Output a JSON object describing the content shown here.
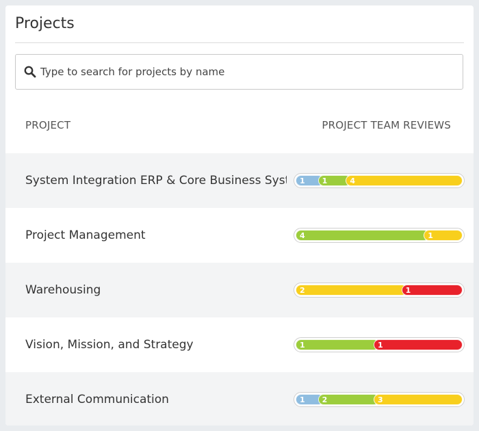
{
  "title": "Projects",
  "search": {
    "placeholder": "Type to search for projects by name"
  },
  "columns": {
    "project": "PROJECT",
    "reviews": "PROJECT TEAM REVIEWS"
  },
  "colors": {
    "blue": "#8fbde0",
    "green": "#9ccd3c",
    "yellow": "#f8cf1d",
    "red": "#e8222b"
  },
  "projects": [
    {
      "name": "System Integration ERP & Core Business Syste",
      "reviews": [
        {
          "status": "blue",
          "count": 1
        },
        {
          "status": "green",
          "count": 1
        },
        {
          "status": "yellow",
          "count": 4
        }
      ]
    },
    {
      "name": "Project Management",
      "reviews": [
        {
          "status": "green",
          "count": 4
        },
        {
          "status": "yellow",
          "count": 1
        }
      ]
    },
    {
      "name": "Warehousing",
      "reviews": [
        {
          "status": "yellow",
          "count": 2
        },
        {
          "status": "red",
          "count": 1
        }
      ]
    },
    {
      "name": "Vision, Mission, and Strategy",
      "reviews": [
        {
          "status": "green",
          "count": 1
        },
        {
          "status": "red",
          "count": 1
        }
      ]
    },
    {
      "name": "External Communication",
      "reviews": [
        {
          "status": "blue",
          "count": 1
        },
        {
          "status": "green",
          "count": 2
        },
        {
          "status": "yellow",
          "count": 3
        }
      ]
    }
  ]
}
